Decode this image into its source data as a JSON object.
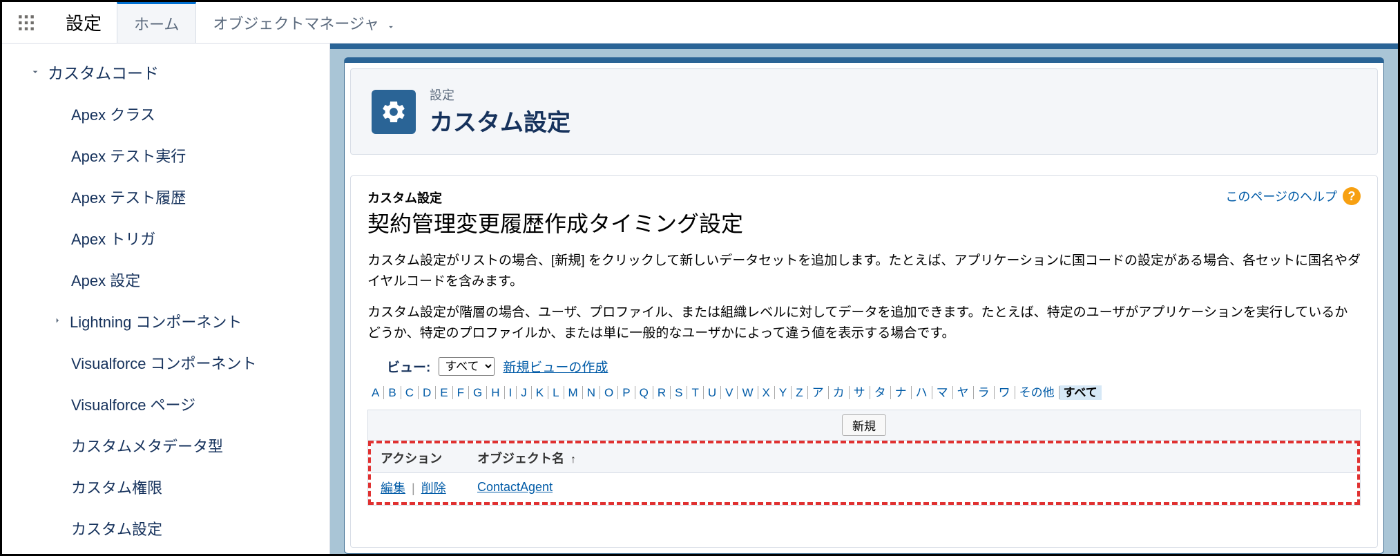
{
  "app": {
    "title": "設定"
  },
  "tabs": {
    "home": "ホーム",
    "obj_mgr": "オブジェクトマネージャ"
  },
  "sidebar": {
    "parent": "カスタムコード",
    "items": [
      "Apex クラス",
      "Apex テスト実行",
      "Apex テスト履歴",
      "Apex トリガ",
      "Apex 設定",
      "Lightning コンポーネント",
      "Visualforce コンポーネント",
      "Visualforce ページ",
      "カスタムメタデータ型",
      "カスタム権限",
      "カスタム設定"
    ]
  },
  "header": {
    "crumb": "設定",
    "title": "カスタム設定"
  },
  "help": {
    "label": "このページのヘルプ"
  },
  "section": {
    "crumb": "カスタム設定",
    "title": "契約管理変更履歴作成タイミング設定",
    "desc1": "カスタム設定がリストの場合、[新規] をクリックして新しいデータセットを追加します。たとえば、アプリケーションに国コードの設定がある場合、各セットに国名やダイヤルコードを含みます。",
    "desc2": "カスタム設定が階層の場合、ユーザ、プロファイル、または組織レベルに対してデータを追加できます。たとえば、特定のユーザがアプリケーションを実行しているかどうか、特定のプロファイルか、または単に一般的なユーザかによって違う値を表示する場合です。"
  },
  "view": {
    "label": "ビュー:",
    "selected": "すべて",
    "new_view": "新規ビューの作成"
  },
  "alpha": {
    "letters": [
      "A",
      "B",
      "C",
      "D",
      "E",
      "F",
      "G",
      "H",
      "I",
      "J",
      "K",
      "L",
      "M",
      "N",
      "O",
      "P",
      "Q",
      "R",
      "S",
      "T",
      "U",
      "V",
      "W",
      "X",
      "Y",
      "Z",
      "ア",
      "カ",
      "サ",
      "タ",
      "ナ",
      "ハ",
      "マ",
      "ヤ",
      "ラ",
      "ワ"
    ],
    "other": "その他",
    "all": "すべて"
  },
  "table": {
    "new_btn": "新規",
    "col_action": "アクション",
    "col_obj": "オブジェクト名",
    "sort": "↑",
    "edit": "編集",
    "del": "削除",
    "row0_name": "ContactAgent"
  }
}
